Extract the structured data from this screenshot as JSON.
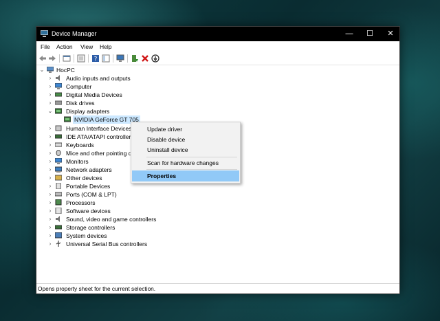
{
  "window": {
    "title": "Device Manager",
    "minimize": "—",
    "maximize": "☐",
    "close": "✕"
  },
  "menu": [
    "File",
    "Action",
    "View",
    "Help"
  ],
  "toolbar": {
    "icons": [
      "back-icon",
      "forward-icon",
      "properties-view-icon",
      "show-hidden-icon",
      "help-icon",
      "console-tree-icon",
      "scan-hardware-icon",
      "update-driver-icon",
      "uninstall-icon",
      "disable-icon"
    ]
  },
  "tree": {
    "root": "HocPC",
    "items": [
      {
        "label": "Audio inputs and outputs",
        "icon": "speaker-icon"
      },
      {
        "label": "Computer",
        "icon": "monitor-icon"
      },
      {
        "label": "Digital Media Devices",
        "icon": "media-device-icon"
      },
      {
        "label": "Disk drives",
        "icon": "disk-drive-icon"
      },
      {
        "label": "Display adapters",
        "icon": "display-adapter-icon",
        "expanded": true
      },
      {
        "label": "NVIDIA GeForce GT 705",
        "icon": "display-adapter-icon",
        "child": true,
        "selected": true
      },
      {
        "label": "Human Interface Devices",
        "icon": "hid-icon"
      },
      {
        "label": "IDE ATA/ATAPI controllers",
        "icon": "ide-controller-icon"
      },
      {
        "label": "Keyboards",
        "icon": "keyboard-icon"
      },
      {
        "label": "Mice and other pointing d",
        "icon": "mouse-icon"
      },
      {
        "label": "Monitors",
        "icon": "monitor-icon"
      },
      {
        "label": "Network adapters",
        "icon": "network-adapter-icon"
      },
      {
        "label": "Other devices",
        "icon": "unknown-device-icon"
      },
      {
        "label": "Portable Devices",
        "icon": "portable-device-icon"
      },
      {
        "label": "Ports (COM & LPT)",
        "icon": "port-icon"
      },
      {
        "label": "Processors",
        "icon": "processor-icon"
      },
      {
        "label": "Software devices",
        "icon": "software-device-icon"
      },
      {
        "label": "Sound, video and game controllers",
        "icon": "speaker-icon"
      },
      {
        "label": "Storage controllers",
        "icon": "storage-controller-icon"
      },
      {
        "label": "System devices",
        "icon": "system-device-icon"
      },
      {
        "label": "Universal Serial Bus controllers",
        "icon": "usb-icon"
      }
    ]
  },
  "context_menu": {
    "items": [
      "Update driver",
      "Disable device",
      "Uninstall device",
      "Scan for hardware changes",
      "Properties"
    ],
    "highlighted": "Properties"
  },
  "status": "Opens property sheet for the current selection.",
  "colors": {
    "titlebar": "#000000",
    "selection": "#cce8ff",
    "menu_highlight": "#91c9f7",
    "desktop": "#0d3d42"
  }
}
